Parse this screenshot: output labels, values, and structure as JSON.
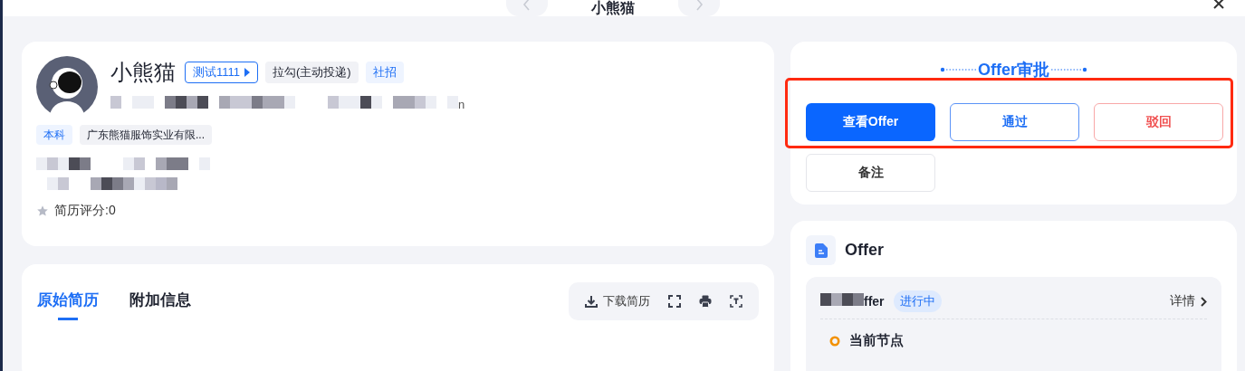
{
  "top_bar": {
    "title": "小熊猫"
  },
  "candidate": {
    "name": "小熊猫",
    "tags": [
      {
        "label": "测试1111",
        "kind": "link"
      },
      {
        "label": "拉勾(主动投递)",
        "kind": "plain"
      },
      {
        "label": "社招",
        "kind": "blue"
      }
    ],
    "contact_suffix": "n",
    "education": [
      {
        "label": "本科",
        "kind": "blue"
      },
      {
        "label": "广东熊猫服饰实业有限...",
        "kind": "plain"
      }
    ],
    "rating": "简历评分:0"
  },
  "resume": {
    "tabs": [
      {
        "label": "原始简历",
        "selected": true
      },
      {
        "label": "附加信息",
        "selected": false
      }
    ],
    "tools": [
      {
        "kind": "download",
        "label": "下载简历"
      },
      {
        "kind": "fullscreen"
      },
      {
        "kind": "print"
      },
      {
        "kind": "scan"
      }
    ]
  },
  "approval": {
    "title": "Offer审批",
    "buttons": [
      {
        "label": "查看Offer",
        "kind": "primary"
      },
      {
        "label": "通过",
        "kind": "outline"
      },
      {
        "label": "驳回",
        "kind": "danger"
      },
      {
        "label": "备注",
        "kind": "plain"
      }
    ]
  },
  "offer": {
    "title": "Offer",
    "item": {
      "name": "ffer",
      "status": "进行中",
      "link": "详情"
    },
    "node": "当前节点"
  }
}
